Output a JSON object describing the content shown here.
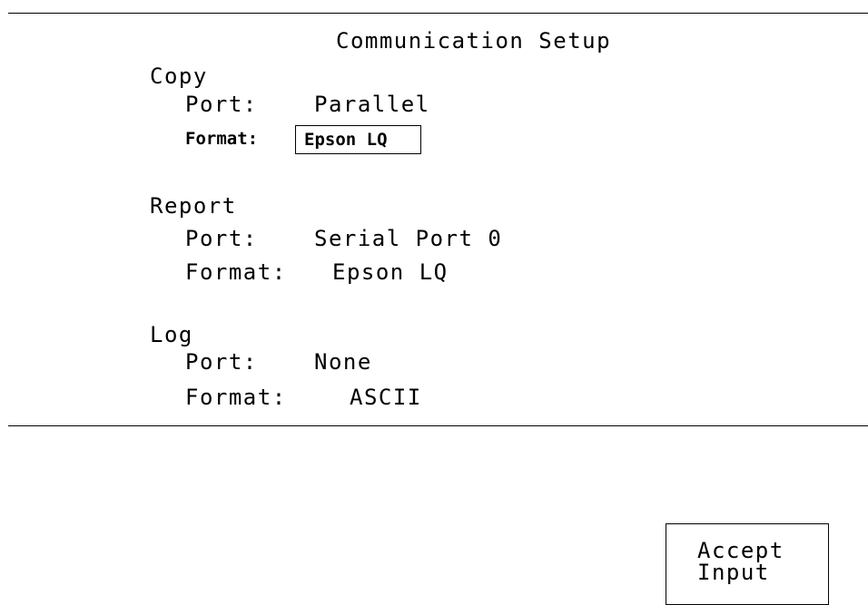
{
  "screen": {
    "title": "Communication Setup"
  },
  "sections": {
    "copy": {
      "header": "Copy",
      "port_label": "Port:",
      "port_value": "Parallel",
      "format_label": "Format:",
      "format_value": "Epson LQ"
    },
    "report": {
      "header": "Report",
      "port_label": "Port:",
      "port_value": "Serial Port 0",
      "format_label": "Format:",
      "format_value": "Epson LQ"
    },
    "log": {
      "header": "Log",
      "port_label": "Port:",
      "port_value": "None",
      "format_label": "Format:",
      "format_value": "ASCII"
    }
  },
  "softkeys": {
    "accept_line1": "Accept",
    "accept_line2": "Input"
  },
  "colors": {
    "background": "#ffffff",
    "foreground": "#000000"
  }
}
